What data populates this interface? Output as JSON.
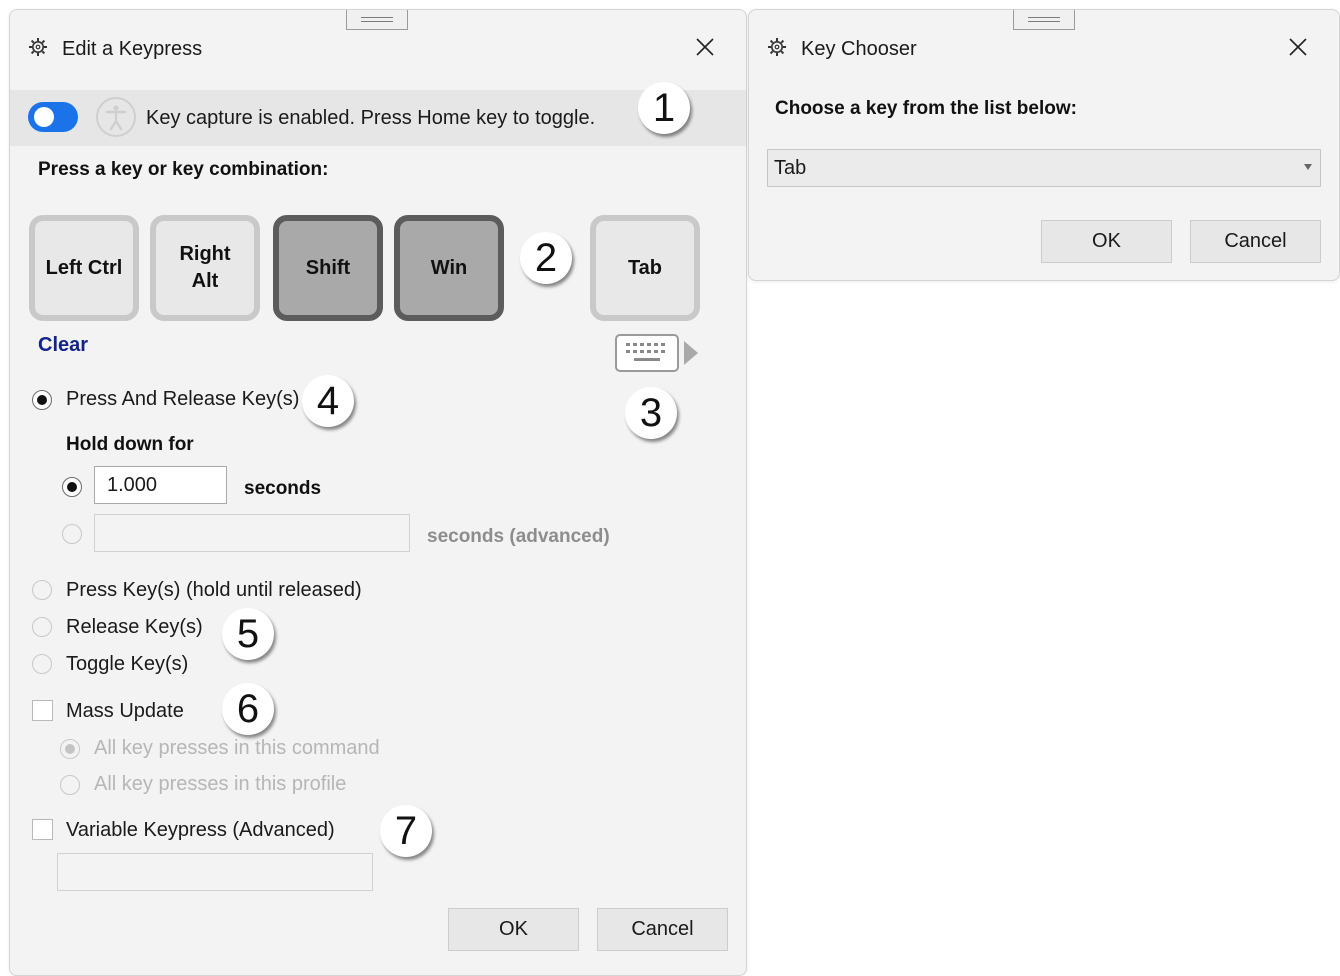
{
  "edit_window": {
    "title": "Edit a Keypress",
    "info_text": "Key capture is enabled. Press Home key to toggle.",
    "press_prompt": "Press a key or key combination:",
    "keys": [
      {
        "label": "Left Ctrl",
        "active": false
      },
      {
        "label": "Right\nAlt",
        "active": false
      },
      {
        "label": "Shift",
        "active": true
      },
      {
        "label": "Win",
        "active": true
      },
      {
        "label": "Tab",
        "active": false
      }
    ],
    "clear_link": "Clear",
    "press_release_label": "Press And Release Key(s)",
    "hold_down_label": "Hold down for",
    "hold_value": "1.000",
    "seconds_label": "seconds",
    "seconds_advanced_label": "seconds (advanced)",
    "press_hold_label": "Press Key(s) (hold until released)",
    "release_label": "Release Key(s)",
    "toggle_label": "Toggle Key(s)",
    "mass_update_label": "Mass Update",
    "mass_opt_command": "All key presses in this command",
    "mass_opt_profile": "All key presses in this profile",
    "variable_label": "Variable Keypress (Advanced)",
    "ok": "OK",
    "cancel": "Cancel"
  },
  "chooser_window": {
    "title": "Key Chooser",
    "prompt": "Choose a key from the list below:",
    "selected_key": "Tab",
    "ok": "OK",
    "cancel": "Cancel"
  },
  "callouts": [
    "1",
    "2",
    "3",
    "4",
    "5",
    "6",
    "7"
  ],
  "colors": {
    "toggle_on": "#1a73e8",
    "link": "#12248c",
    "key_active_border": "#5c5c5c"
  }
}
